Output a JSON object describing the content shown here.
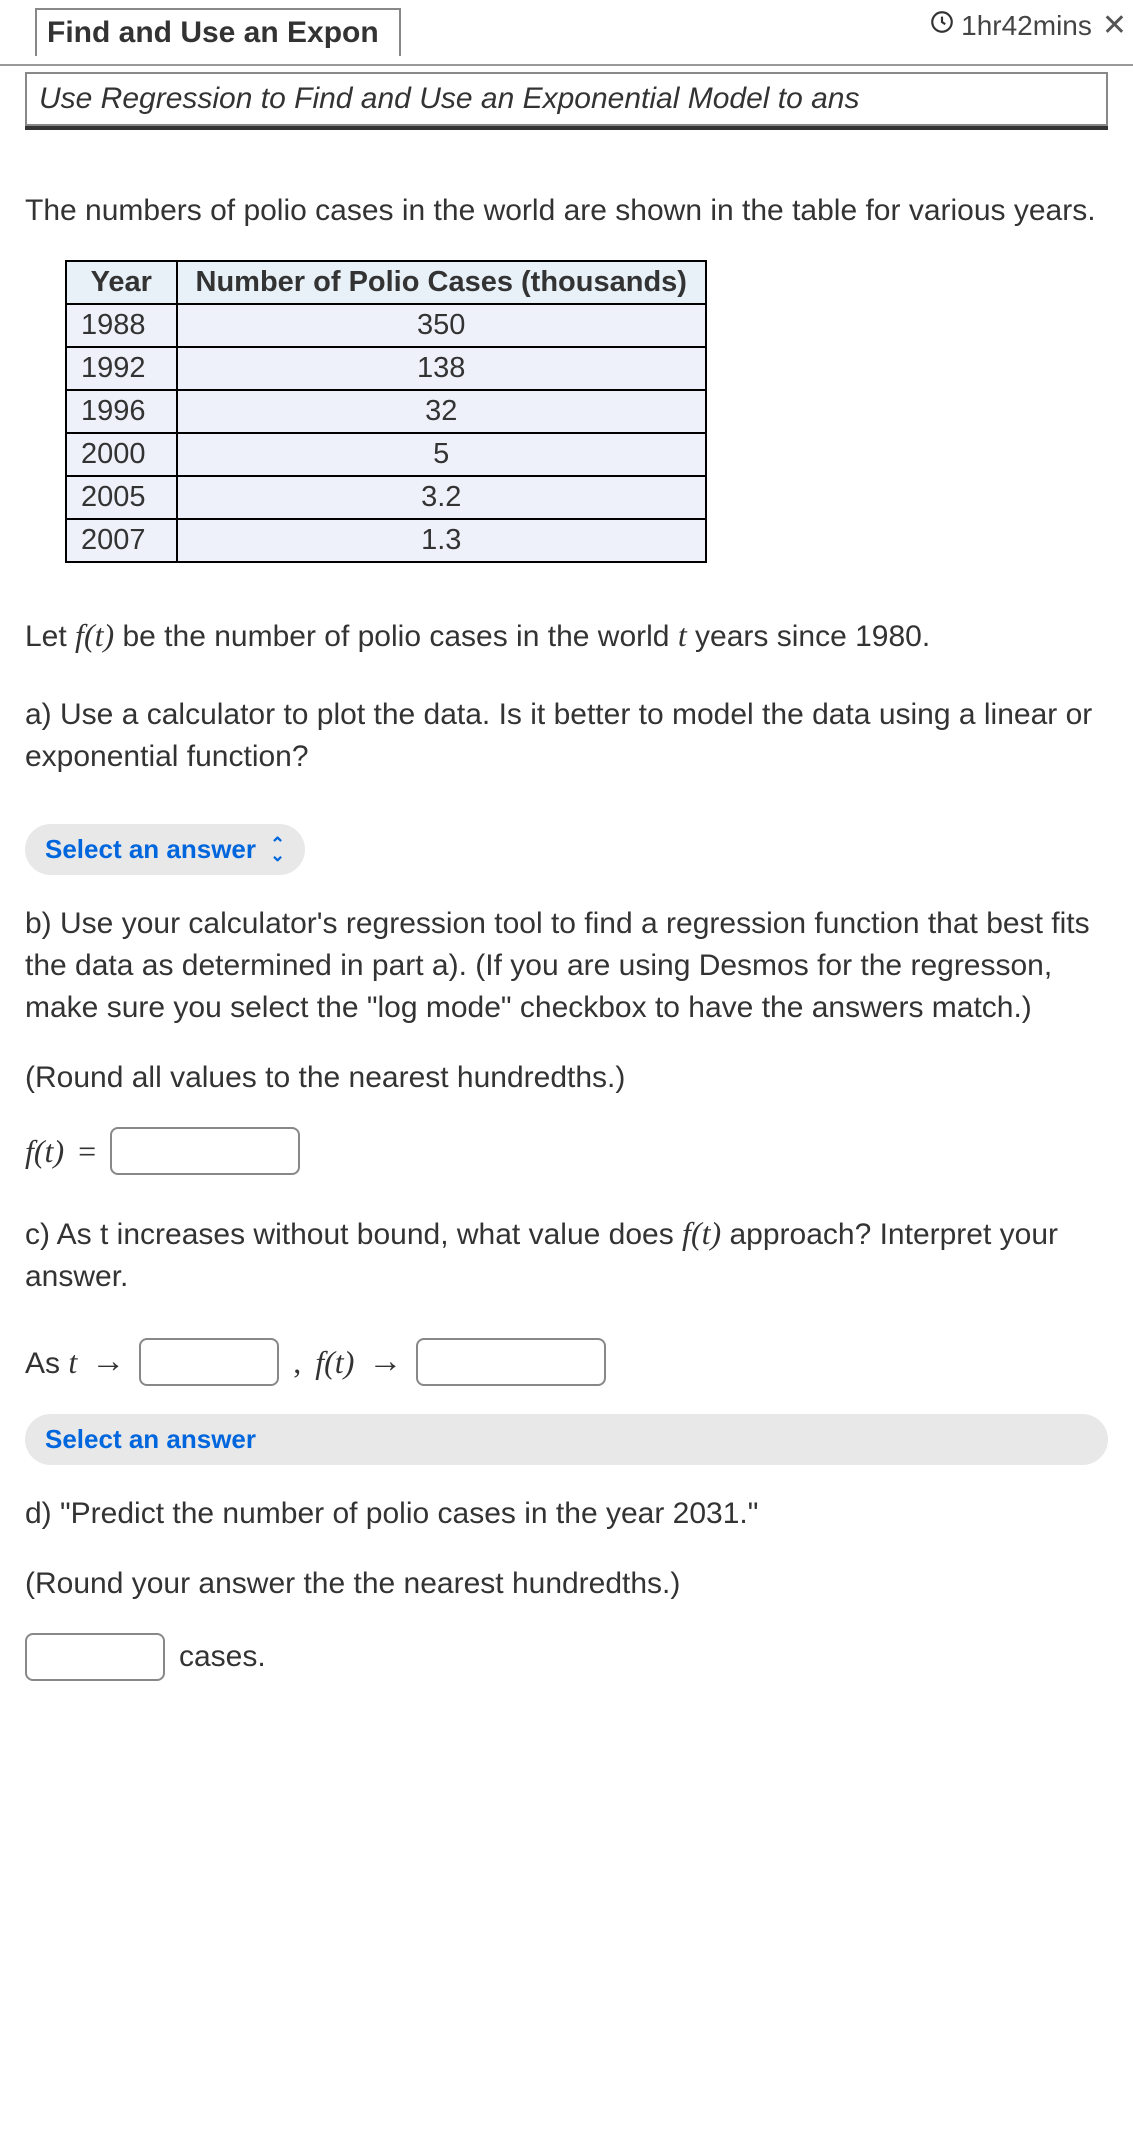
{
  "header": {
    "tab_title": "Find and Use an Expon",
    "timer": "1hr42mins",
    "subtab": "Use Regression to Find and Use an Exponential Model to ans"
  },
  "intro": "The numbers of polio cases in the world are shown in the table for various years.",
  "chart_data": {
    "type": "table",
    "columns": [
      "Year",
      "Number of Polio Cases (thousands)"
    ],
    "rows": [
      {
        "year": "1988",
        "cases": "350"
      },
      {
        "year": "1992",
        "cases": "138"
      },
      {
        "year": "1996",
        "cases": "32"
      },
      {
        "year": "2000",
        "cases": "5"
      },
      {
        "year": "2005",
        "cases": "3.2"
      },
      {
        "year": "2007",
        "cases": "1.3"
      }
    ]
  },
  "let_text_pre": "Let ",
  "let_fn": "f(t)",
  "let_text_mid": " be the number of polio cases in the world ",
  "let_var": "t",
  "let_text_post": " years since 1980.",
  "part_a": "a) Use a calculator to plot the data. Is it better to model the data using a linear or exponential function?",
  "select_label": "Select an answer",
  "part_b": "b) Use your calculator's regression tool to find a regression function that best fits the data as determined in part a). (If you are using Desmos for the regresson, make sure you select the \"log mode\" checkbox to have the answers match.)",
  "round_b": "(Round all values to the nearest hundredths.)",
  "ft_eq_lhs": "f(t)",
  "eq_sign": " = ",
  "part_c_pre": "c) As t increases without bound, what value does ",
  "part_c_fn": "f(t)",
  "part_c_post": " approach? Interpret your answer.",
  "as_t": "As ",
  "as_t_var": "t",
  "arrow": " → ",
  "comma": " , ",
  "ft_arrow": "f(t)",
  "part_d": "d) \"Predict the number of polio cases in the year 2031.\"",
  "round_d": "(Round your answer the the nearest hundredths.)",
  "cases_label": "cases."
}
